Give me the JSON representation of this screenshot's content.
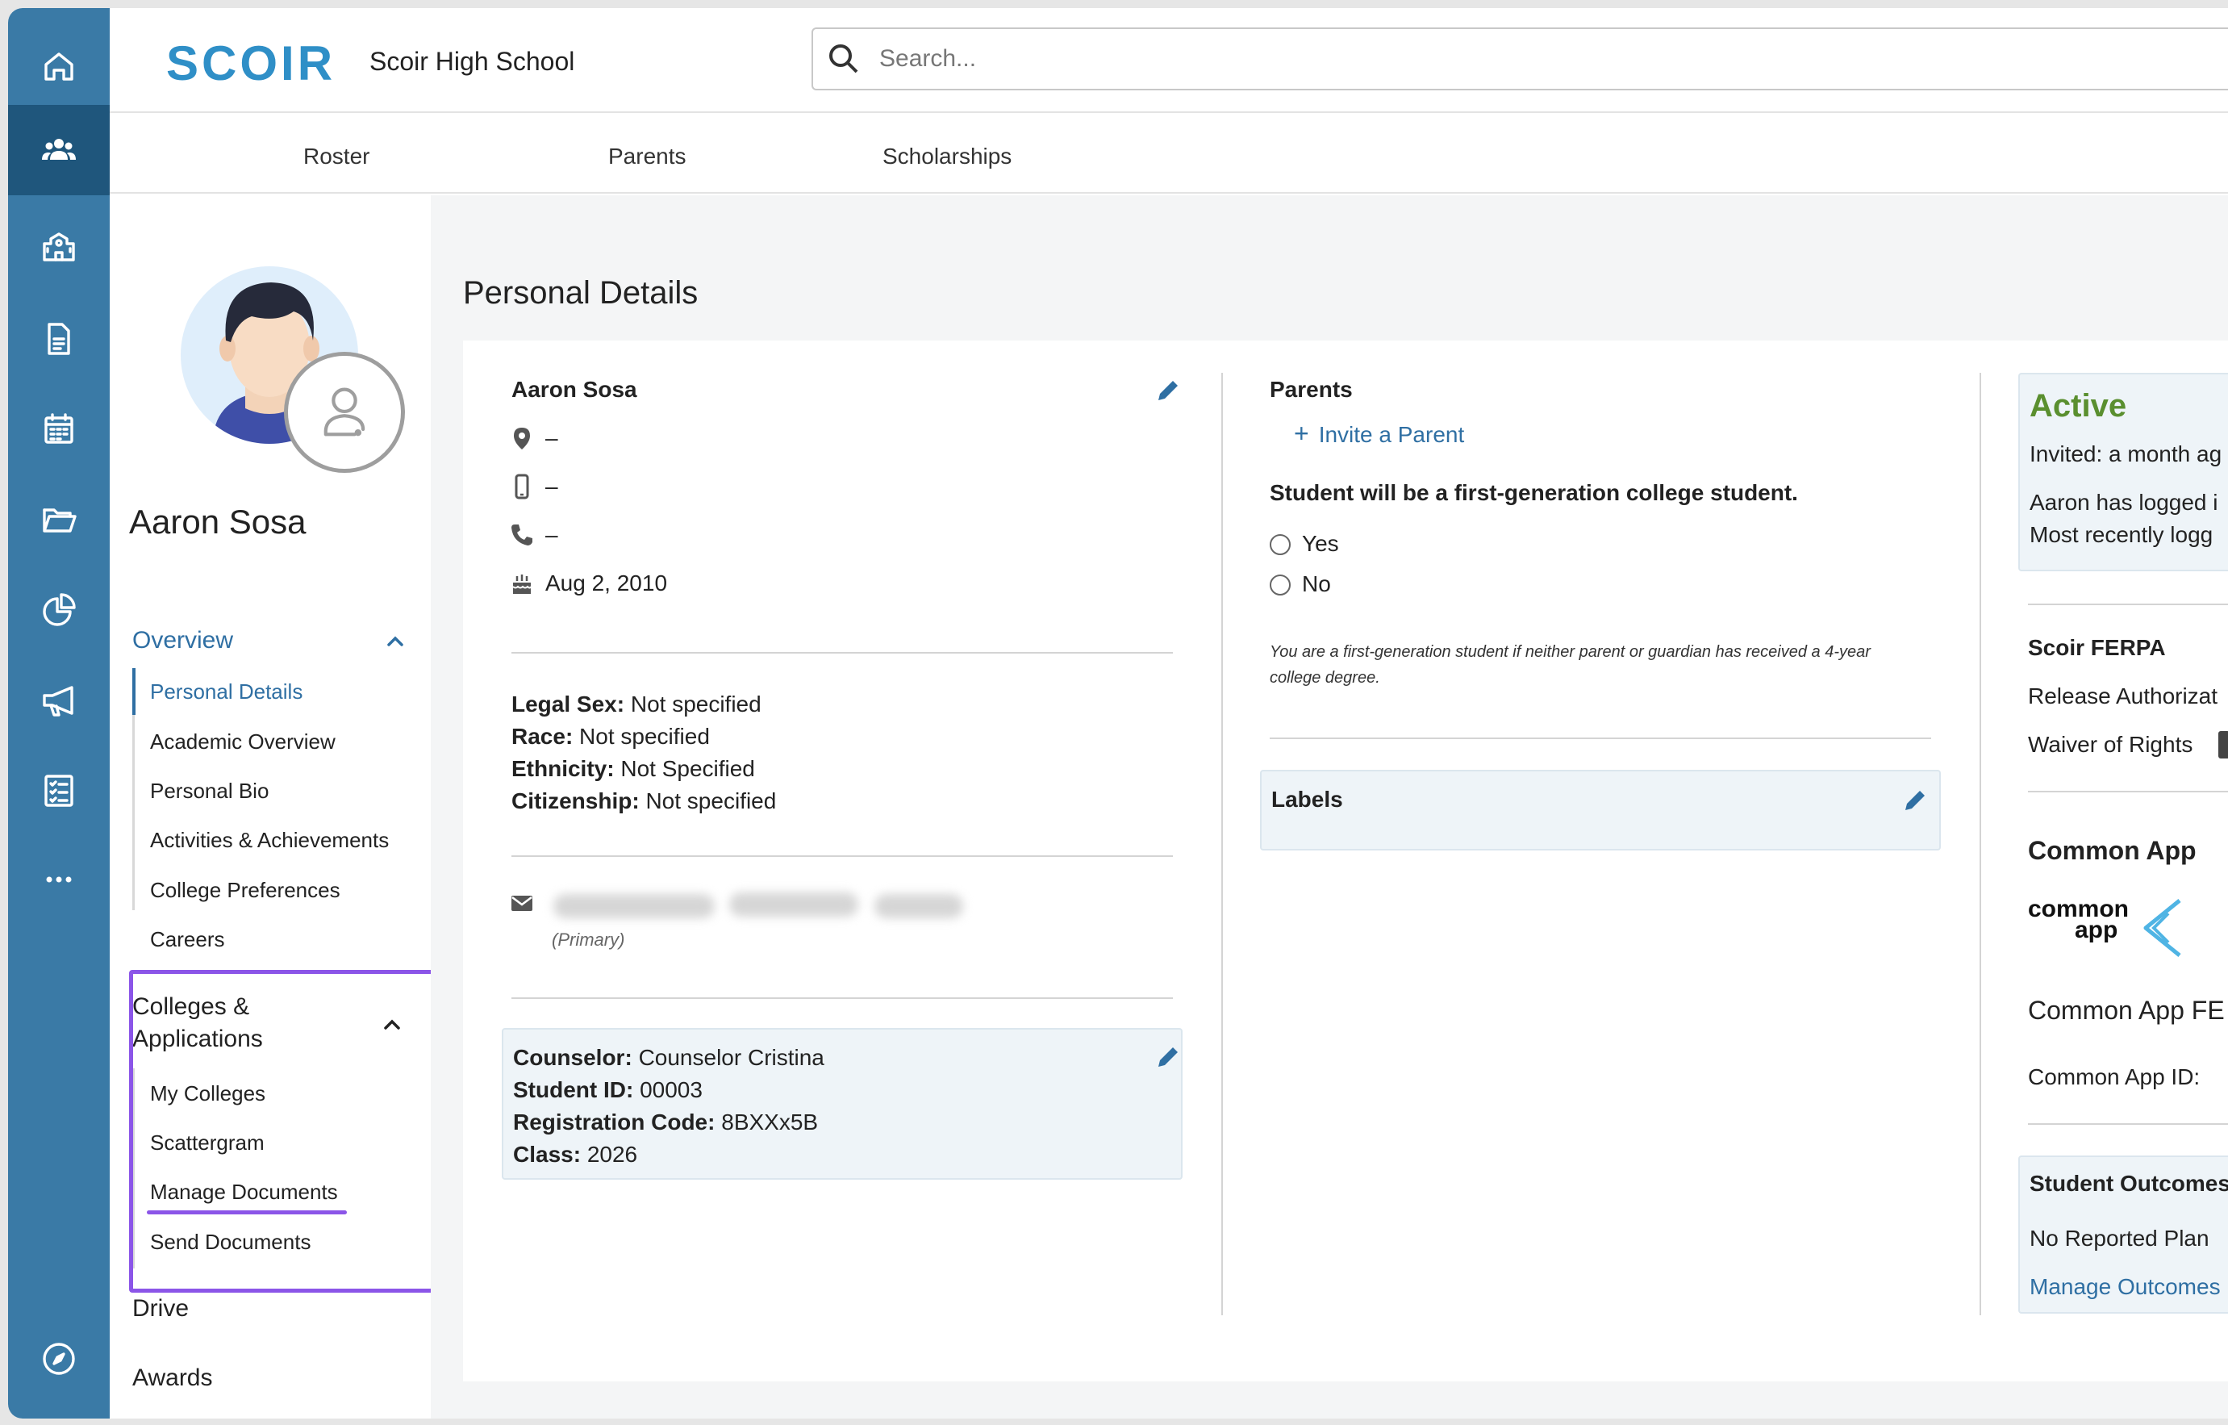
{
  "header": {
    "logo": "SCOIR",
    "school_name": "Scoir High School",
    "search_placeholder": "Search..."
  },
  "nav_tabs": [
    "Roster",
    "Parents",
    "Scholarships"
  ],
  "rail_icons": [
    "home-icon",
    "people-icon",
    "school-icon",
    "document-icon",
    "calendar-icon",
    "folder-icon",
    "pie-chart-icon",
    "megaphone-icon",
    "checklist-icon",
    "more-icon",
    "compass-icon"
  ],
  "sidebar": {
    "student_name": "Aaron Sosa",
    "overview": {
      "label": "Overview",
      "items": [
        "Personal Details",
        "Academic Overview",
        "Personal Bio",
        "Activities & Achievements",
        "College Preferences",
        "Careers"
      ]
    },
    "colleges": {
      "label_line1": "Colleges &",
      "label_line2": "Applications",
      "items": [
        "My Colleges",
        "Scattergram",
        "Manage Documents",
        "Send Documents"
      ]
    },
    "drive": "Drive",
    "awards": "Awards"
  },
  "page_title": "Personal Details",
  "contact": {
    "name": "Aaron Sosa",
    "address": "–",
    "mobile": "–",
    "phone": "–",
    "birthday": "Aug 2, 2010",
    "legal_sex_label": "Legal Sex:",
    "legal_sex": "Not specified",
    "race_label": "Race:",
    "race": "Not specified",
    "ethnicity_label": "Ethnicity:",
    "ethnicity": "Not Specified",
    "citizenship_label": "Citizenship:",
    "citizenship": "Not specified",
    "email_note": "(Primary)"
  },
  "counselor_box": {
    "counselor_label": "Counselor:",
    "counselor": "Counselor Cristina",
    "student_id_label": "Student ID:",
    "student_id": "00003",
    "reg_code_label": "Registration Code:",
    "reg_code": "8BXXx5B",
    "class_label": "Class:",
    "class": "2026"
  },
  "parents": {
    "heading": "Parents",
    "invite": "Invite a Parent",
    "first_gen_question": "Student will be a first-generation college student.",
    "yes": "Yes",
    "no": "No",
    "note_line1": "You are a first-generation student if neither parent or guardian has received a 4-year",
    "note_line2": "college degree."
  },
  "labels": {
    "heading": "Labels"
  },
  "status": {
    "active": "Active",
    "invited": "Invited: a month ag",
    "logged_line1": "Aaron has logged i",
    "logged_line2": "Most recently logg",
    "ferpa_heading": "Scoir FERPA",
    "release": "Release Authorizat",
    "waiver": "Waiver of Rights",
    "common_app_heading": "Common App",
    "common_app_logo_1": "common",
    "common_app_logo_2": "app",
    "common_app_fe": "Common App FE",
    "common_app_id": "Common App ID:",
    "outcomes_heading": "Student Outcomes",
    "no_plan": "No Reported Plan",
    "manage_outcomes": "Manage Outcomes"
  },
  "colors": {
    "rail": "#3a7aa6",
    "rail_active": "#1f567c",
    "accent_blue": "#2f6fa3",
    "active_green": "#5a8f2f",
    "highlight_purple": "#8b55e8"
  }
}
